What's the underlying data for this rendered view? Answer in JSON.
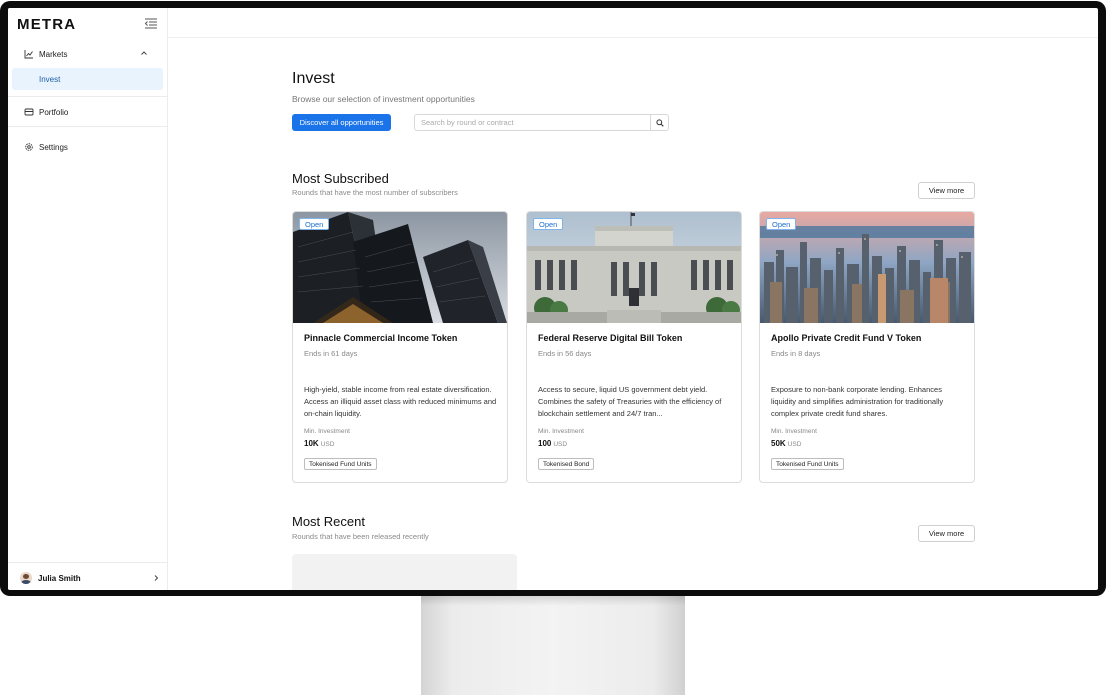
{
  "brand": {
    "logo": "METRA"
  },
  "sidebar": {
    "markets_label": "Markets",
    "invest_label": "Invest",
    "portfolio_label": "Portfolio",
    "settings_label": "Settings",
    "user_name": "Julia Smith"
  },
  "main": {
    "title": "Invest",
    "subtitle": "Browse our selection of investment opportunities",
    "discover_button": "Discover all opportunities",
    "search_placeholder": "Search by round or contract"
  },
  "sections": {
    "most_subscribed": {
      "title": "Most Subscribed",
      "subtitle": "Rounds that have the most number of subscribers",
      "view_more": "View more",
      "cards": [
        {
          "badge": "Open",
          "title": "Pinnacle Commercial Income Token",
          "ends": "Ends in 61 days",
          "description": "High-yield, stable income from real estate diversification. Access an illiquid asset class with reduced minimums and on-chain liquidity.",
          "min_label": "Min. Investment",
          "min_value": "10K",
          "min_currency": "USD",
          "tag": "Tokenised Fund Units"
        },
        {
          "badge": "Open",
          "title": "Federal Reserve Digital Bill Token",
          "ends": "Ends in 56 days",
          "description": "Access to secure, liquid US government debt yield. Combines the safety of Treasuries with the efficiency of blockchain settlement and 24/7 tran...",
          "min_label": "Min. Investment",
          "min_value": "100",
          "min_currency": "USD",
          "tag": "Tokenised Bond"
        },
        {
          "badge": "Open",
          "title": "Apollo Private Credit Fund V Token",
          "ends": "Ends in 8 days",
          "description": "Exposure to non-bank corporate lending. Enhances liquidity and simplifies administration for traditionally complex private credit fund shares.",
          "min_label": "Min. Investment",
          "min_value": "50K",
          "min_currency": "USD",
          "tag": "Tokenised Fund Units"
        }
      ]
    },
    "most_recent": {
      "title": "Most Recent",
      "subtitle": "Rounds that have been released recently",
      "view_more": "View more"
    }
  },
  "colors": {
    "primary": "#1a73e8",
    "active_nav_bg": "#e8f3fd",
    "badge_text": "#1a6fd0"
  }
}
